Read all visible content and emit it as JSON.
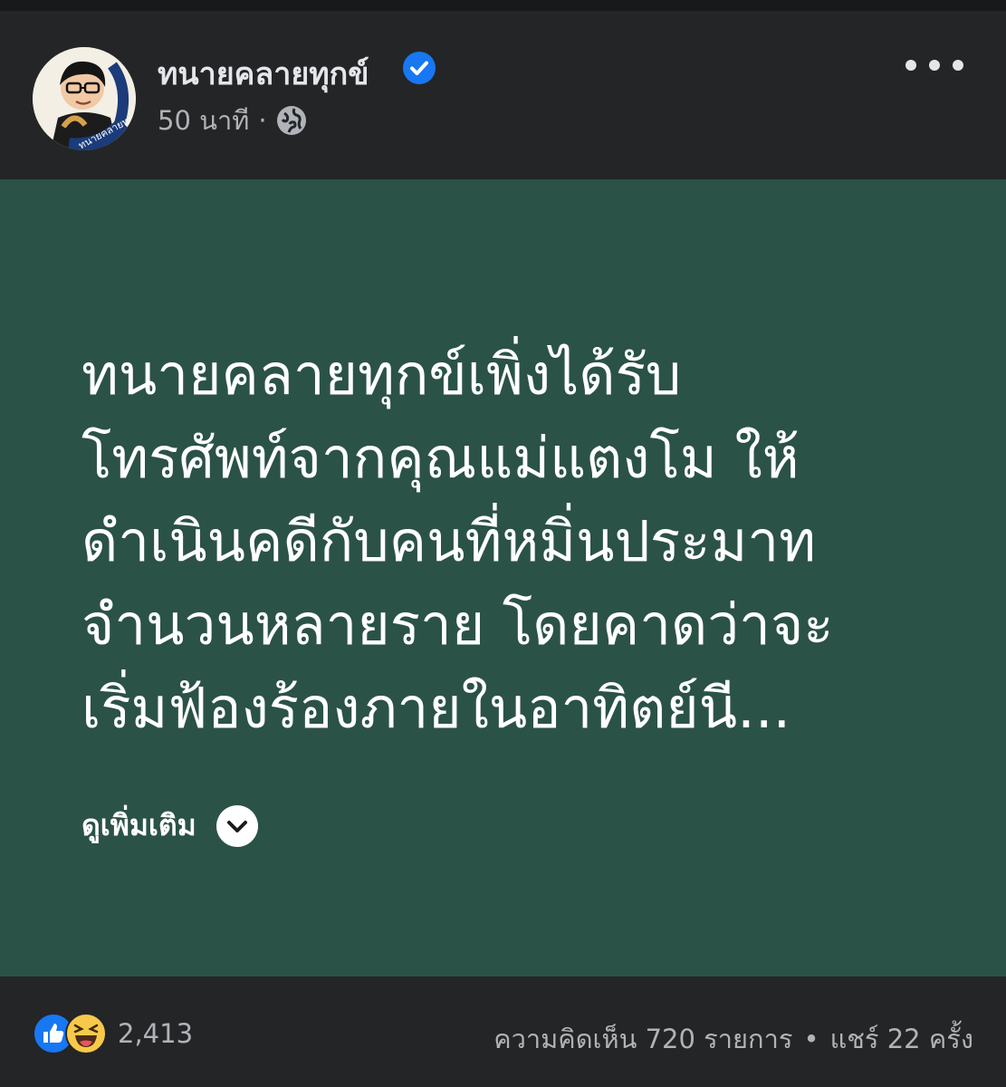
{
  "post": {
    "page_name": "ทนายคลายทุกข์",
    "time": "50 นาที",
    "separator": "·",
    "avatar_caption": "ทนายคลายทุกข์",
    "text_lines": [
      "ทนายคลายทุกข์เพิ่งได้รับ",
      "โทรศัพท์จากคุณแม่แตงโม ให้",
      "ดำเนินคดีกับคนที่หมิ่นประมาท",
      "จำนวนหลายราย โดยคาดว่าจะ",
      "เริ่มฟ้องร้องภายในอาทิตย์นี..."
    ],
    "see_more": "ดูเพิ่มเติม",
    "background_color": "#2b5247"
  },
  "footer": {
    "reaction_count": "2,413",
    "comments": "ความคิดเห็น 720 รายการ",
    "dot": "•",
    "shares": "แชร์ 22 ครั้ง"
  },
  "icons": {
    "verified": "verified-badge-icon",
    "privacy": "globe-icon",
    "more": "more-options-icon",
    "see_more": "chevron-down-icon",
    "like": "like-reaction-icon",
    "haha": "haha-reaction-icon"
  },
  "colors": {
    "accent_blue": "#1877f2",
    "header_bg": "#242526",
    "text_primary": "#e4e6eb",
    "text_secondary": "#b0b3b8"
  }
}
